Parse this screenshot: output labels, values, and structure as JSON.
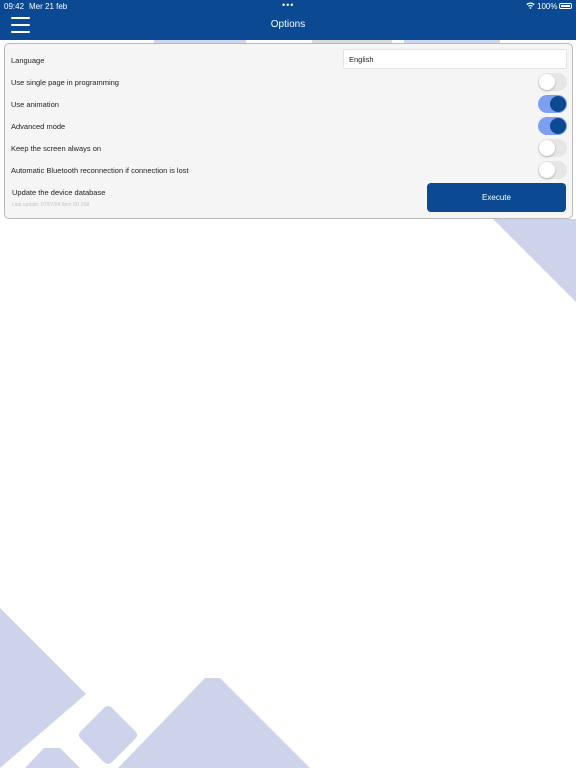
{
  "status_bar": {
    "time": "09:42",
    "date": "Mer 21 feb",
    "dots": "•••",
    "battery": "100%"
  },
  "header": {
    "title": "Options",
    "menu_icon": "hamburger-menu-icon"
  },
  "options": {
    "language": {
      "label": "Language",
      "value": "English"
    },
    "single_page": {
      "label": "Use single page in programming",
      "enabled": false
    },
    "animation": {
      "label": "Use animation",
      "enabled": true
    },
    "advanced": {
      "label": "Advanced mode",
      "enabled": true
    },
    "screen_on": {
      "label": "Keep the screen always on",
      "enabled": false
    },
    "bt_reconnect": {
      "label": "Automatic Bluetooth reconnection if connection is lost",
      "enabled": false
    },
    "update_db": {
      "label": "Update the device database",
      "last_update": "Last update: 07/07/84 8pm 5D 3Sil",
      "button": "Execute"
    }
  },
  "colors": {
    "primary": "#0b4a93",
    "toggle_on_track": "#7e9ff0",
    "toggle_off_track": "#e6e6e6",
    "decoration": "#ced3ec"
  }
}
